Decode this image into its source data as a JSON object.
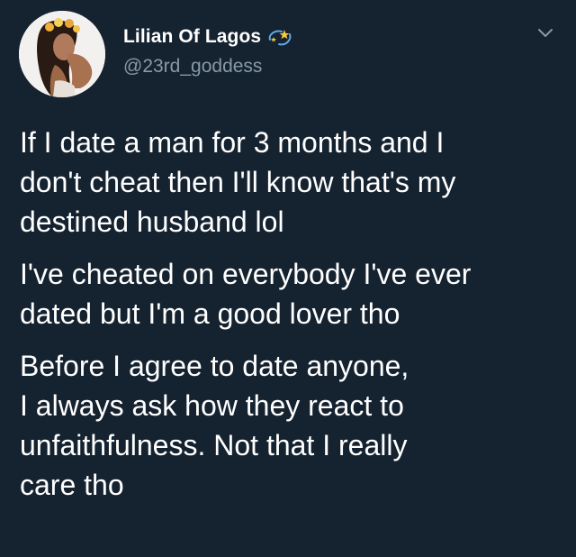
{
  "author": {
    "display_name": "Lilian Of Lagos",
    "name_emoji_icon": "dizzy-star-emoji-icon",
    "handle": "@23rd_goddess",
    "avatar_icon": "profile-photo-avatar"
  },
  "menu": {
    "icon": "chevron-down-icon"
  },
  "tweet": {
    "paragraphs": [
      "If I date a man for 3 months and I\ndon't cheat then I'll know that's my\ndestined husband lol",
      "I've cheated on everybody I've ever\ndated but I'm a good lover tho",
      "Before I agree to date anyone,\nI always ask how they react to\nunfaithfulness. Not that I really\ncare tho"
    ]
  },
  "colors": {
    "background": "#152230",
    "text": "#ffffff",
    "handle": "#8899a6",
    "chevron": "#8899a6"
  }
}
